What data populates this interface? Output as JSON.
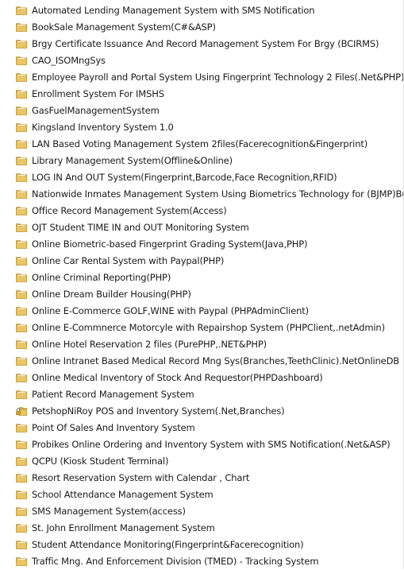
{
  "colors": {
    "folder_front": "#e8c566",
    "folder_back": "#d4a83a",
    "folder_edge": "#b88a22",
    "lock_body": "#c9a227",
    "lock_shackle": "#777777"
  },
  "folders": [
    {
      "label": "Automated Lending Management System with SMS Notification",
      "icon": "folder-icon"
    },
    {
      "label": "BookSale Management System(C#&ASP)",
      "icon": "folder-icon"
    },
    {
      "label": "Brgy Certificate Issuance And Record Management System For Brgy (BCIRMS)",
      "icon": "folder-icon"
    },
    {
      "label": "CAO_ISOMngSys",
      "icon": "folder-icon"
    },
    {
      "label": "Employee Payroll and Portal System Using Fingerprint Technology 2 Files(.Net&PHP)",
      "icon": "folder-icon"
    },
    {
      "label": "Enrollment System For IMSHS",
      "icon": "folder-icon"
    },
    {
      "label": "GasFuelManagementSystem",
      "icon": "folder-icon"
    },
    {
      "label": "Kingsland Inventory System 1.0",
      "icon": "folder-icon"
    },
    {
      "label": "LAN Based Voting Management System 2files(Facerecognition&Fingerprint)",
      "icon": "folder-icon"
    },
    {
      "label": "Library Management System(Offline&Online)",
      "icon": "folder-icon"
    },
    {
      "label": "LOG IN And OUT System(Fingerprint,Barcode,Face Recognition,RFID)",
      "icon": "folder-icon"
    },
    {
      "label": "Nationwide Inmates Management System Using Biometrics Technology for (BJMP)Bu...",
      "icon": "folder-icon"
    },
    {
      "label": "Office Record Management System(Access)",
      "icon": "folder-icon"
    },
    {
      "label": "OJT Student TIME IN and OUT Monitoring System",
      "icon": "folder-icon"
    },
    {
      "label": "Online Biometric-based Fingerprint Grading System(Java,PHP)",
      "icon": "folder-icon"
    },
    {
      "label": "Online Car Rental System with Paypal(PHP)",
      "icon": "folder-icon"
    },
    {
      "label": "Online Criminal Reporting(PHP)",
      "icon": "folder-icon"
    },
    {
      "label": "Online Dream Builder Housing(PHP)",
      "icon": "folder-icon"
    },
    {
      "label": "Online E-Commerce GOLF,WINE with Paypal (PHPAdminClient)",
      "icon": "folder-icon"
    },
    {
      "label": "Online E-Commnerce Motorcyle  with Repairshop System (PHPClient,.netAdmin)",
      "icon": "folder-icon"
    },
    {
      "label": "Online Hotel Reservation 2 files (PurePHP,.NET&PHP)",
      "icon": "folder-icon"
    },
    {
      "label": "Online Intranet Based Medical Record Mng Sys(Branches,TeethClinic).NetOnlineDB",
      "icon": "folder-icon"
    },
    {
      "label": "Online Medical Inventory of Stock And Requestor(PHPDashboard)",
      "icon": "folder-icon"
    },
    {
      "label": "Patient Record Management System",
      "icon": "folder-icon"
    },
    {
      "label": "PetshopNiRoy POS and Inventory System(.Net,Branches)",
      "icon": "locked-folder-icon"
    },
    {
      "label": "Point Of Sales And Inventory System",
      "icon": "folder-icon"
    },
    {
      "label": "Probikes Online Ordering and Inventory System with SMS Notification(.Net&ASP)",
      "icon": "folder-icon"
    },
    {
      "label": "QCPU (Kiosk Student Terminal)",
      "icon": "folder-icon"
    },
    {
      "label": "Resort Reservation System with Calendar , Chart",
      "icon": "folder-icon"
    },
    {
      "label": "School Attendance Management System",
      "icon": "folder-icon"
    },
    {
      "label": "SMS Management System(access)",
      "icon": "folder-icon"
    },
    {
      "label": "St. John Enrollment Management System",
      "icon": "folder-icon"
    },
    {
      "label": "Student Attendance Monitoring(Fingerprint&Facerecognition)",
      "icon": "folder-icon"
    },
    {
      "label": "Traffic Mng. And Enforcement Division (TMED) - Tracking System",
      "icon": "folder-icon"
    }
  ]
}
